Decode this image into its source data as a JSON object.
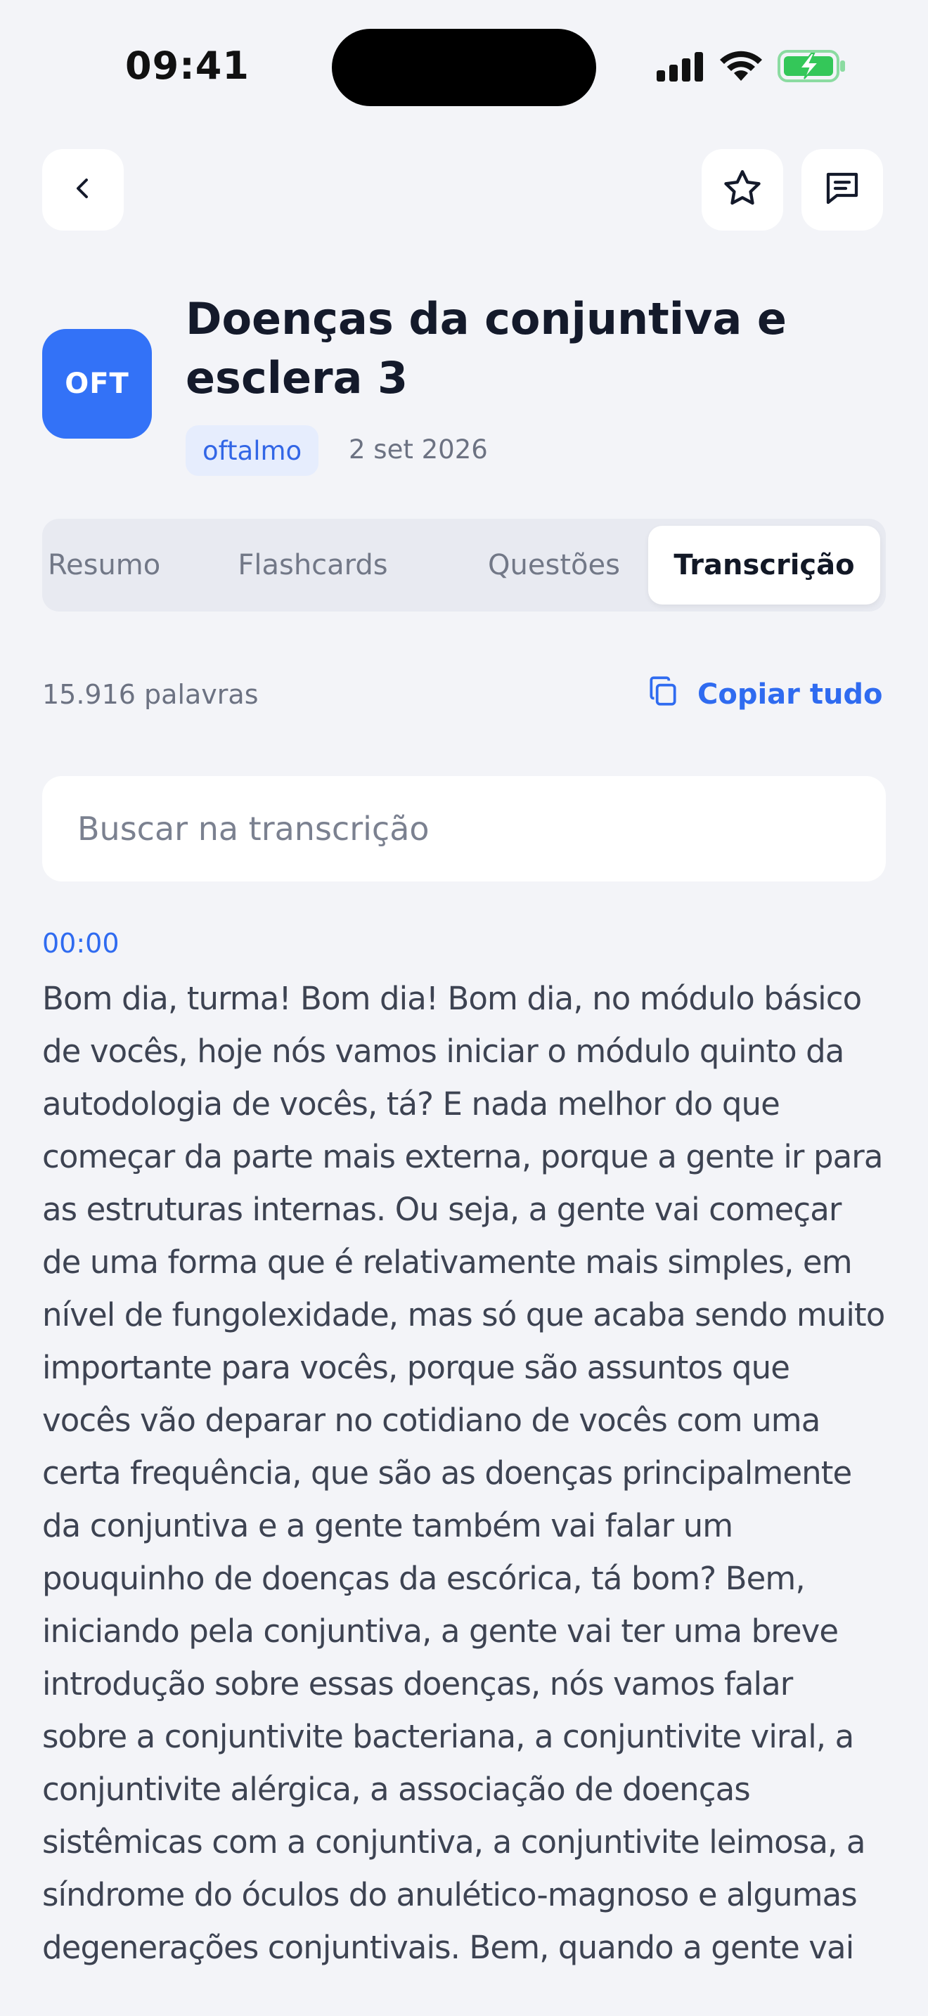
{
  "status_bar": {
    "time": "09:41",
    "icons": [
      "signal-icon",
      "wifi-icon",
      "battery-charging-icon"
    ],
    "battery_color": "#34c759"
  },
  "nav": {
    "back_icon": "chevron-left-icon",
    "favorite_icon": "star-icon",
    "notes_icon": "notes-icon"
  },
  "lesson": {
    "badge": "OFT",
    "badge_color": "#3372f7",
    "title": "Doenças da conjuntiva e esclera 3",
    "tag": "oftalmo",
    "date": "2 set 2026"
  },
  "tabs": [
    {
      "label": "Resumo",
      "active": false
    },
    {
      "label": "Flashcards",
      "active": false
    },
    {
      "label": "Questões",
      "active": false
    },
    {
      "label": "Transcrição",
      "active": true
    }
  ],
  "transcript": {
    "word_count": "15.916 palavras",
    "copy_label": "Copiar tudo",
    "search_placeholder": "Buscar na transcrição",
    "search_value": "",
    "segments": [
      {
        "time": "00:00",
        "text": "Bom dia, turma! Bom dia! Bom dia, no módulo básico de vocês, hoje nós vamos iniciar o módulo quinto da autodologia de vocês, tá? E nada melhor do que começar da parte mais externa, porque a gente ir para as estruturas internas. Ou seja, a gente vai começar de uma forma que é relativamente mais simples, em nível de fungolexidade, mas só que acaba sendo muito importante para vocês, porque são assuntos que vocês vão deparar no cotidiano de vocês com uma certa frequência, que são as doenças principalmente da conjuntiva e a gente também vai falar um pouquinho de doenças da escórica, tá bom? Bem, iniciando pela conjuntiva, a gente vai ter uma breve introdução sobre essas doenças, nós vamos falar sobre a conjuntivite bacteriana, a conjuntivite viral, a conjuntivite alérgica, a associação de doenças sistêmicas com a conjuntiva, a conjuntivite leimosa, a síndrome do óculos do anulético-magnoso e algumas degenerações conjuntivais. Bem, quando a gente vai"
      }
    ]
  },
  "colors": {
    "accent": "#2f6bf0",
    "background": "#f3f4f8"
  }
}
